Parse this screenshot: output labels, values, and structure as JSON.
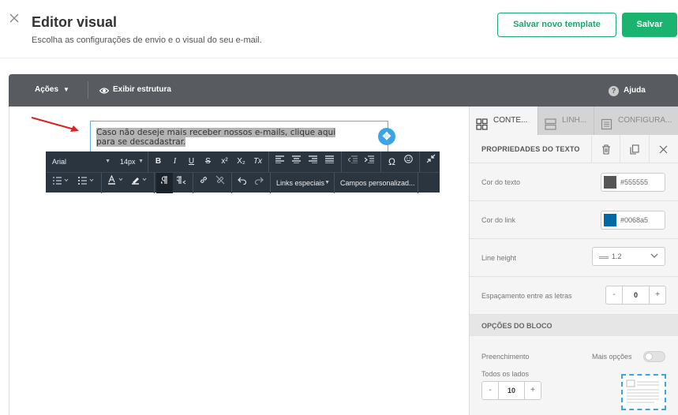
{
  "header": {
    "title": "Editor visual",
    "subtitle": "Escolha as configurações de envio e o visual do seu e-mail.",
    "save_template_label": "Salvar novo template",
    "save_label": "Salvar"
  },
  "topbar": {
    "acoes_label": "Ações",
    "estrutura_label": "Exibir estrutura",
    "help_label": "Ajuda"
  },
  "canvas": {
    "text_content": "Caso não deseje mais receber nossos e-mails, clique aqui para se descadastrar."
  },
  "editor_toolbar": {
    "font_family": "Arial",
    "font_size": "14px",
    "bold": "B",
    "italic": "I",
    "underline": "U",
    "strikethrough": "S",
    "superscript": "x²",
    "subscript": "X₂",
    "clear_format": "Tx",
    "omega": "Ω",
    "links_especiais": "Links especiais",
    "campos_personalizados": "Campos personalizad..."
  },
  "panel": {
    "tabs": [
      {
        "label": "CONTE...",
        "icon": "grid-icon",
        "active": true
      },
      {
        "label": "LINH...",
        "icon": "rows-icon",
        "active": false
      },
      {
        "label": "CONFIGURA...",
        "icon": "settings-doc-icon",
        "active": false
      }
    ],
    "props_title": "PROPRIEDADES DO TEXTO",
    "cor_texto_label": "Cor do texto",
    "cor_texto_value": "#555555",
    "cor_link_label": "Cor do link",
    "cor_link_value": "#0068a5",
    "line_height_label": "Line height",
    "line_height_value": "1.2",
    "letter_spacing_label": "Espaçamento entre as letras",
    "letter_spacing_value": "0",
    "block_options_title": "OPÇÕES DO BLOCO",
    "preenchimento_label": "Preenchimento",
    "mais_opcoes_label": "Mais opções",
    "todos_lados_label": "Todos os lados",
    "padding_value": "10",
    "minus": "-",
    "plus": "+"
  },
  "colors": {
    "accent_green": "#1ab36f",
    "toolbar_dark": "#585b5f",
    "editor_toolbar": "#2b3540",
    "selection_blue": "#3aa5e6"
  }
}
